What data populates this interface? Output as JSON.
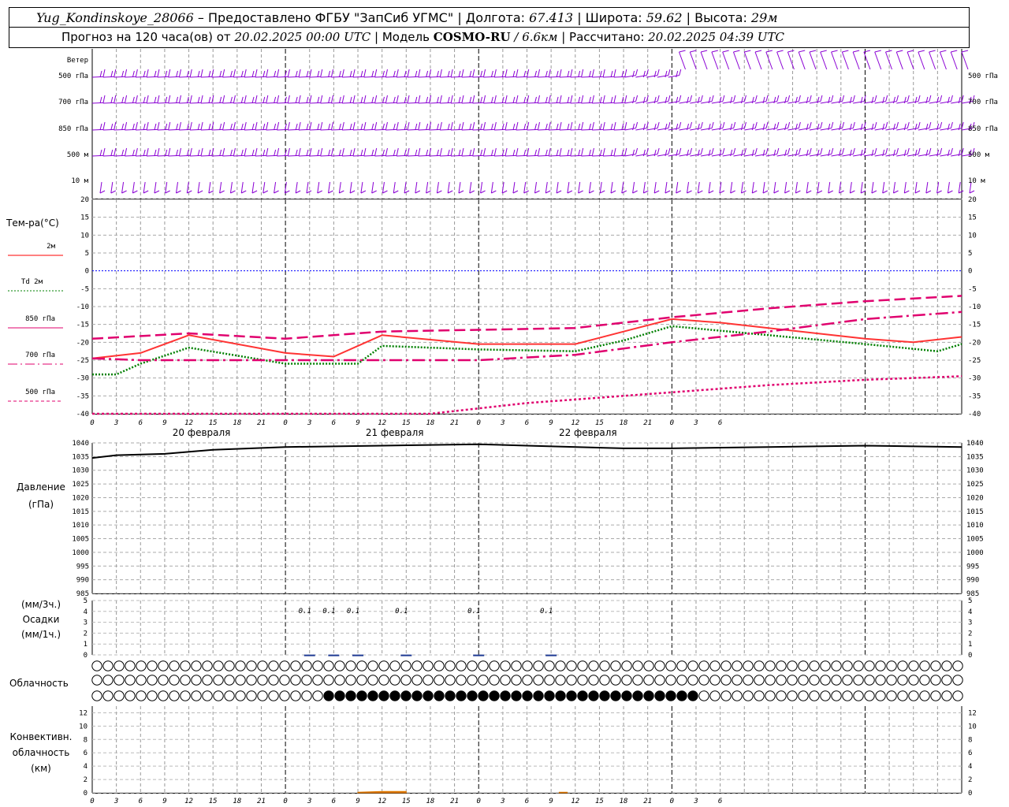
{
  "header": {
    "station": "Yug_Kondinskoye_28066",
    "provider": "– Предоставлено ФГБУ \"ЗапСиб УГМС\"",
    "lon_label": "| Долгота:",
    "lon": "67.413",
    "lat_label": "| Широта:",
    "lat": "59.62",
    "alt_label": "| Высота:",
    "alt": "29м",
    "forecast_prefix": "Прогноз на 120 часа(ов) от",
    "run_time": "20.02.2025 00:00 UTC",
    "model_label": "| Модель",
    "model": "COSMO-RU",
    "resolution": "/ 6.6км",
    "calc_label": "| Рассчитано:",
    "calc_time": "20.02.2025 04:39 UTC"
  },
  "labels": {
    "wind": "Ветер",
    "levels": [
      "500 гПа",
      "700 гПа",
      "850 гПа",
      "500 м",
      "10 м"
    ],
    "temp_title": "Тем-ра(°С)",
    "legend": [
      {
        "label": "2м",
        "color": "#ff0000",
        "dash": ""
      },
      {
        "label": "Td 2м",
        "color": "#008000",
        "dash": "2,2"
      },
      {
        "label": "850 гПа",
        "color": "#e0006e",
        "dash": ""
      },
      {
        "label": "700 гПа",
        "color": "#e0006e",
        "dash": "12,4,2,4"
      },
      {
        "label": "500 гПа",
        "color": "#e0006e",
        "dash": "4,3"
      }
    ],
    "pressure_title": [
      "Давление",
      "(гПа)"
    ],
    "precip_title": [
      "(мм/3ч.)",
      "Осадки",
      "(мм/1ч.)"
    ],
    "cloud_title": "Облачность",
    "conv_title": [
      "Конвективн.",
      "облачность",
      "(км)"
    ],
    "days": [
      "20 февраля",
      "21 февраля",
      "22 февраля"
    ],
    "hour_ticks": [
      "0",
      "3",
      "6",
      "9",
      "12",
      "15",
      "18",
      "21",
      "0",
      "3",
      "6",
      "9",
      "12",
      "15",
      "18",
      "21",
      "0",
      "3",
      "6",
      "9",
      "12",
      "15",
      "18",
      "21",
      "0",
      "3",
      "6"
    ]
  },
  "colors": {
    "wind": "#8a00d4",
    "t2m": "#ff3333",
    "td2m": "#008000",
    "upper": "#e0006e",
    "zero": "#0000ff",
    "precip": "#1f3a93",
    "conv": "#e07a00"
  },
  "chart_data": [
    {
      "type": "line",
      "panel": "temperature",
      "title": "Тем-ра(°С)",
      "x_unit": "hours since 20.02.2025 00:00 UTC",
      "ylim": [
        -40,
        20
      ],
      "yticks": [
        20,
        15,
        10,
        5,
        0,
        -5,
        -10,
        -15,
        -20,
        -25,
        -30,
        -35,
        -40
      ],
      "series": [
        {
          "name": "2м",
          "x": [
            0,
            6,
            12,
            24,
            30,
            36,
            48,
            60,
            66,
            72,
            78,
            84,
            90,
            96,
            102,
            108
          ],
          "values": [
            -24.5,
            -23,
            -18,
            -23,
            -24,
            -18,
            -20.5,
            -20.5,
            -17,
            -13.5,
            -14.5,
            -16,
            -17.5,
            -19,
            -20,
            -18.5
          ]
        },
        {
          "name": "Td 2м",
          "x": [
            0,
            3,
            6,
            12,
            24,
            33,
            36,
            48,
            60,
            66,
            72,
            84,
            96,
            105,
            108
          ],
          "values": [
            -29,
            -29,
            -26,
            -21.5,
            -26,
            -26,
            -21,
            -22,
            -22.5,
            -19.5,
            -15.5,
            -18,
            -20.5,
            -22.5,
            -20.5
          ]
        },
        {
          "name": "850 гПа",
          "x": [
            0,
            12,
            24,
            36,
            48,
            60,
            72,
            84,
            96,
            108
          ],
          "values": [
            -19,
            -17.5,
            -19,
            -17,
            -16.5,
            -16,
            -13,
            -10.5,
            -8.5,
            -7
          ]
        },
        {
          "name": "700 гПа",
          "x": [
            0,
            6,
            12,
            24,
            36,
            48,
            60,
            72,
            84,
            96,
            108
          ],
          "values": [
            -24.5,
            -25,
            -25,
            -25,
            -25,
            -25,
            -23.5,
            -20,
            -17,
            -13.5,
            -11.5
          ]
        },
        {
          "name": "500 гПа",
          "x": [
            0,
            6,
            12,
            24,
            36,
            42,
            48,
            54,
            60,
            66,
            72,
            84,
            96,
            108
          ],
          "values": [
            -40,
            -40,
            -40,
            -40,
            -40,
            -40,
            -38.5,
            -37,
            -36,
            -35,
            -34,
            -32,
            -30.5,
            -29.5
          ]
        }
      ]
    },
    {
      "type": "line",
      "panel": "pressure",
      "title": "Давление (гПа)",
      "ylim": [
        985,
        1040
      ],
      "yticks": [
        1040,
        1035,
        1030,
        1025,
        1020,
        1015,
        1010,
        1005,
        1000,
        995,
        990,
        985
      ],
      "series": [
        {
          "name": "Давление",
          "x": [
            0,
            3,
            9,
            15,
            24,
            36,
            48,
            54,
            66,
            72,
            84,
            96,
            108
          ],
          "values": [
            1034.5,
            1035.5,
            1036,
            1037.5,
            1038.5,
            1039,
            1039.5,
            1039,
            1038,
            1038,
            1038.5,
            1039,
            1038.5
          ]
        }
      ]
    },
    {
      "type": "bar",
      "panel": "precipitation",
      "title": "Осадки (мм/3ч.)",
      "ylim": [
        0,
        5
      ],
      "x": [
        27,
        30,
        33,
        39,
        48,
        57
      ],
      "values": [
        0.1,
        0.1,
        0.1,
        0.1,
        0.1,
        0.1
      ],
      "labels": [
        "0.1",
        "0.1",
        "0.1",
        "0.1",
        "0.1",
        "0.1"
      ]
    },
    {
      "type": "table",
      "panel": "cloudiness",
      "title": "Облачность",
      "rows": [
        "upper",
        "middle",
        "lower"
      ],
      "steps_per_row": 80,
      "overcast_lower_from_step": 21,
      "overcast_lower_to_step": 54
    },
    {
      "type": "area",
      "panel": "convective",
      "title": "Конвективн. облачность (км)",
      "ylim": [
        0,
        13
      ],
      "yticks": [
        12,
        10,
        8,
        6,
        4,
        2,
        0
      ],
      "series": [
        {
          "name": "Конвективн. облачность",
          "x": [
            33,
            36,
            39
          ],
          "values": [
            0.1,
            0.2,
            0.2
          ]
        },
        {
          "name": "Конвективн. облачность",
          "x": [
            58,
            59
          ],
          "values": [
            0.1,
            0.1
          ]
        }
      ]
    }
  ]
}
